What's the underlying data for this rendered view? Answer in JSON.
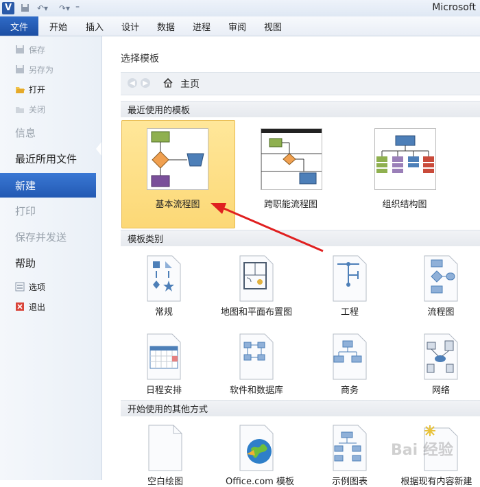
{
  "app": {
    "title": "Microsoft"
  },
  "ribbon": {
    "file": "文件",
    "tabs": [
      "开始",
      "插入",
      "设计",
      "数据",
      "进程",
      "审阅",
      "视图"
    ]
  },
  "nav": {
    "save": "保存",
    "save_as": "另存为",
    "open": "打开",
    "close": "关闭",
    "info": "信息",
    "recent": "最近所用文件",
    "new": "新建",
    "print": "打印",
    "save_send": "保存并发送",
    "help": "帮助",
    "options": "选项",
    "exit": "退出"
  },
  "main": {
    "title": "选择模板",
    "breadcrumb": "主页",
    "recent_section": "最近使用的模板",
    "recent_templates": [
      "基本流程图",
      "跨职能流程图",
      "组织结构图"
    ],
    "category_section": "模板类别",
    "categories": [
      "常规",
      "地图和平面布置图",
      "工程",
      "流程图",
      "日程安排",
      "软件和数据库",
      "商务",
      "网络"
    ],
    "other_section": "开始使用的其他方式",
    "other": [
      "空白绘图",
      "Office.com 模板",
      "示例图表",
      "根据现有内容新建"
    ]
  },
  "watermark": "Bai 经验",
  "colors": {
    "accent": "#2259b3",
    "selected": "#fcd876",
    "annotation": "#e02020"
  }
}
